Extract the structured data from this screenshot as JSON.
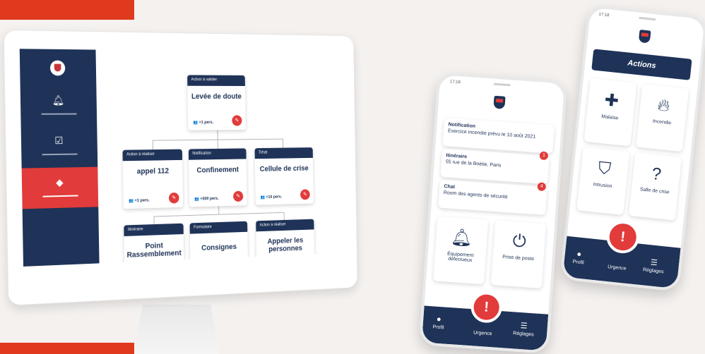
{
  "colors": {
    "navy": "#1f3358",
    "red": "#e23b3b",
    "accent": "#e03a1e"
  },
  "desktop": {
    "sidebar": {
      "items": [
        {
          "icon": "shield-logo-icon"
        },
        {
          "icon": "bell-icon"
        },
        {
          "icon": "checklist-icon"
        },
        {
          "icon": "alert-diamond-icon",
          "active": true
        }
      ]
    },
    "root": {
      "header": "Action à valider",
      "title": "Levée de doute",
      "pers": "+1 pers."
    },
    "row1": [
      {
        "header": "Action à réaliser",
        "title": "appel 112",
        "pers": "+1 pers."
      },
      {
        "header": "Notification",
        "title": "Confinement",
        "pers": "+500 pers."
      },
      {
        "header": "Tchat",
        "title": "Cellule de crise",
        "pers": "+10 pers."
      }
    ],
    "row2": [
      {
        "header": "Itinéraire",
        "title": "Point Rassemblement"
      },
      {
        "header": "Formulaire",
        "title": "Consignes"
      },
      {
        "header": "Action à réaliser",
        "title": "Appeler les personnes"
      }
    ]
  },
  "phone_left": {
    "status_time": "17:18",
    "notifications": [
      {
        "title": "Notification",
        "text": "Exercice incendie prévu le 10 août 2021"
      },
      {
        "title": "Itinéraire",
        "text": "55 rue de la Boétie, Paris",
        "badge": "1"
      },
      {
        "title": "Chat",
        "text": "Room des agents de sécurité",
        "badge": "4"
      }
    ],
    "tiles": [
      {
        "label": "Équipement défectueux",
        "icon": "bell-alarm-icon"
      },
      {
        "label": "Prise de poste",
        "icon": "power-icon"
      }
    ],
    "tabs": {
      "profile": "Profil",
      "urgence": "Urgence",
      "settings": "Réglages"
    }
  },
  "phone_right": {
    "status_time": "17:18",
    "title": "Actions",
    "tiles": [
      {
        "label": "Malaise",
        "icon": "medkit-icon"
      },
      {
        "label": "Incendie",
        "icon": "flame-icon"
      },
      {
        "label": "Intrusion",
        "icon": "shield-off-icon"
      },
      {
        "label": "Salle de crise",
        "icon": "question-icon"
      }
    ],
    "tabs": {
      "profile": "Profil",
      "urgence": "Urgence",
      "settings": "Réglages"
    }
  }
}
